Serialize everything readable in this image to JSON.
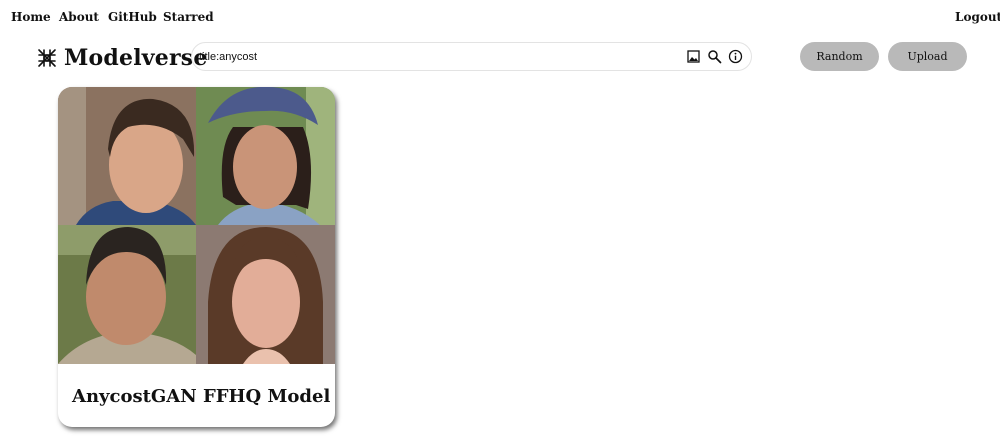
{
  "nav": {
    "home": "Home",
    "about": "About",
    "github": "GitHub",
    "starred": "Starred",
    "logout": "Logout"
  },
  "brand": {
    "title": "Modelverse",
    "logo_icon": "knot-logo-icon"
  },
  "search": {
    "value": "title:anycost",
    "icons": [
      "image-search-icon",
      "search-icon",
      "info-icon"
    ]
  },
  "buttons": {
    "random": "Random",
    "upload": "Upload"
  },
  "results": [
    {
      "title": "AnycostGAN FFHQ Model ...",
      "thumbnail": "2x2 grid of generated face portraits"
    }
  ],
  "colors": {
    "button_bg": "#b9b9b9",
    "text": "#111111",
    "search_border": "#e3e3e3"
  }
}
